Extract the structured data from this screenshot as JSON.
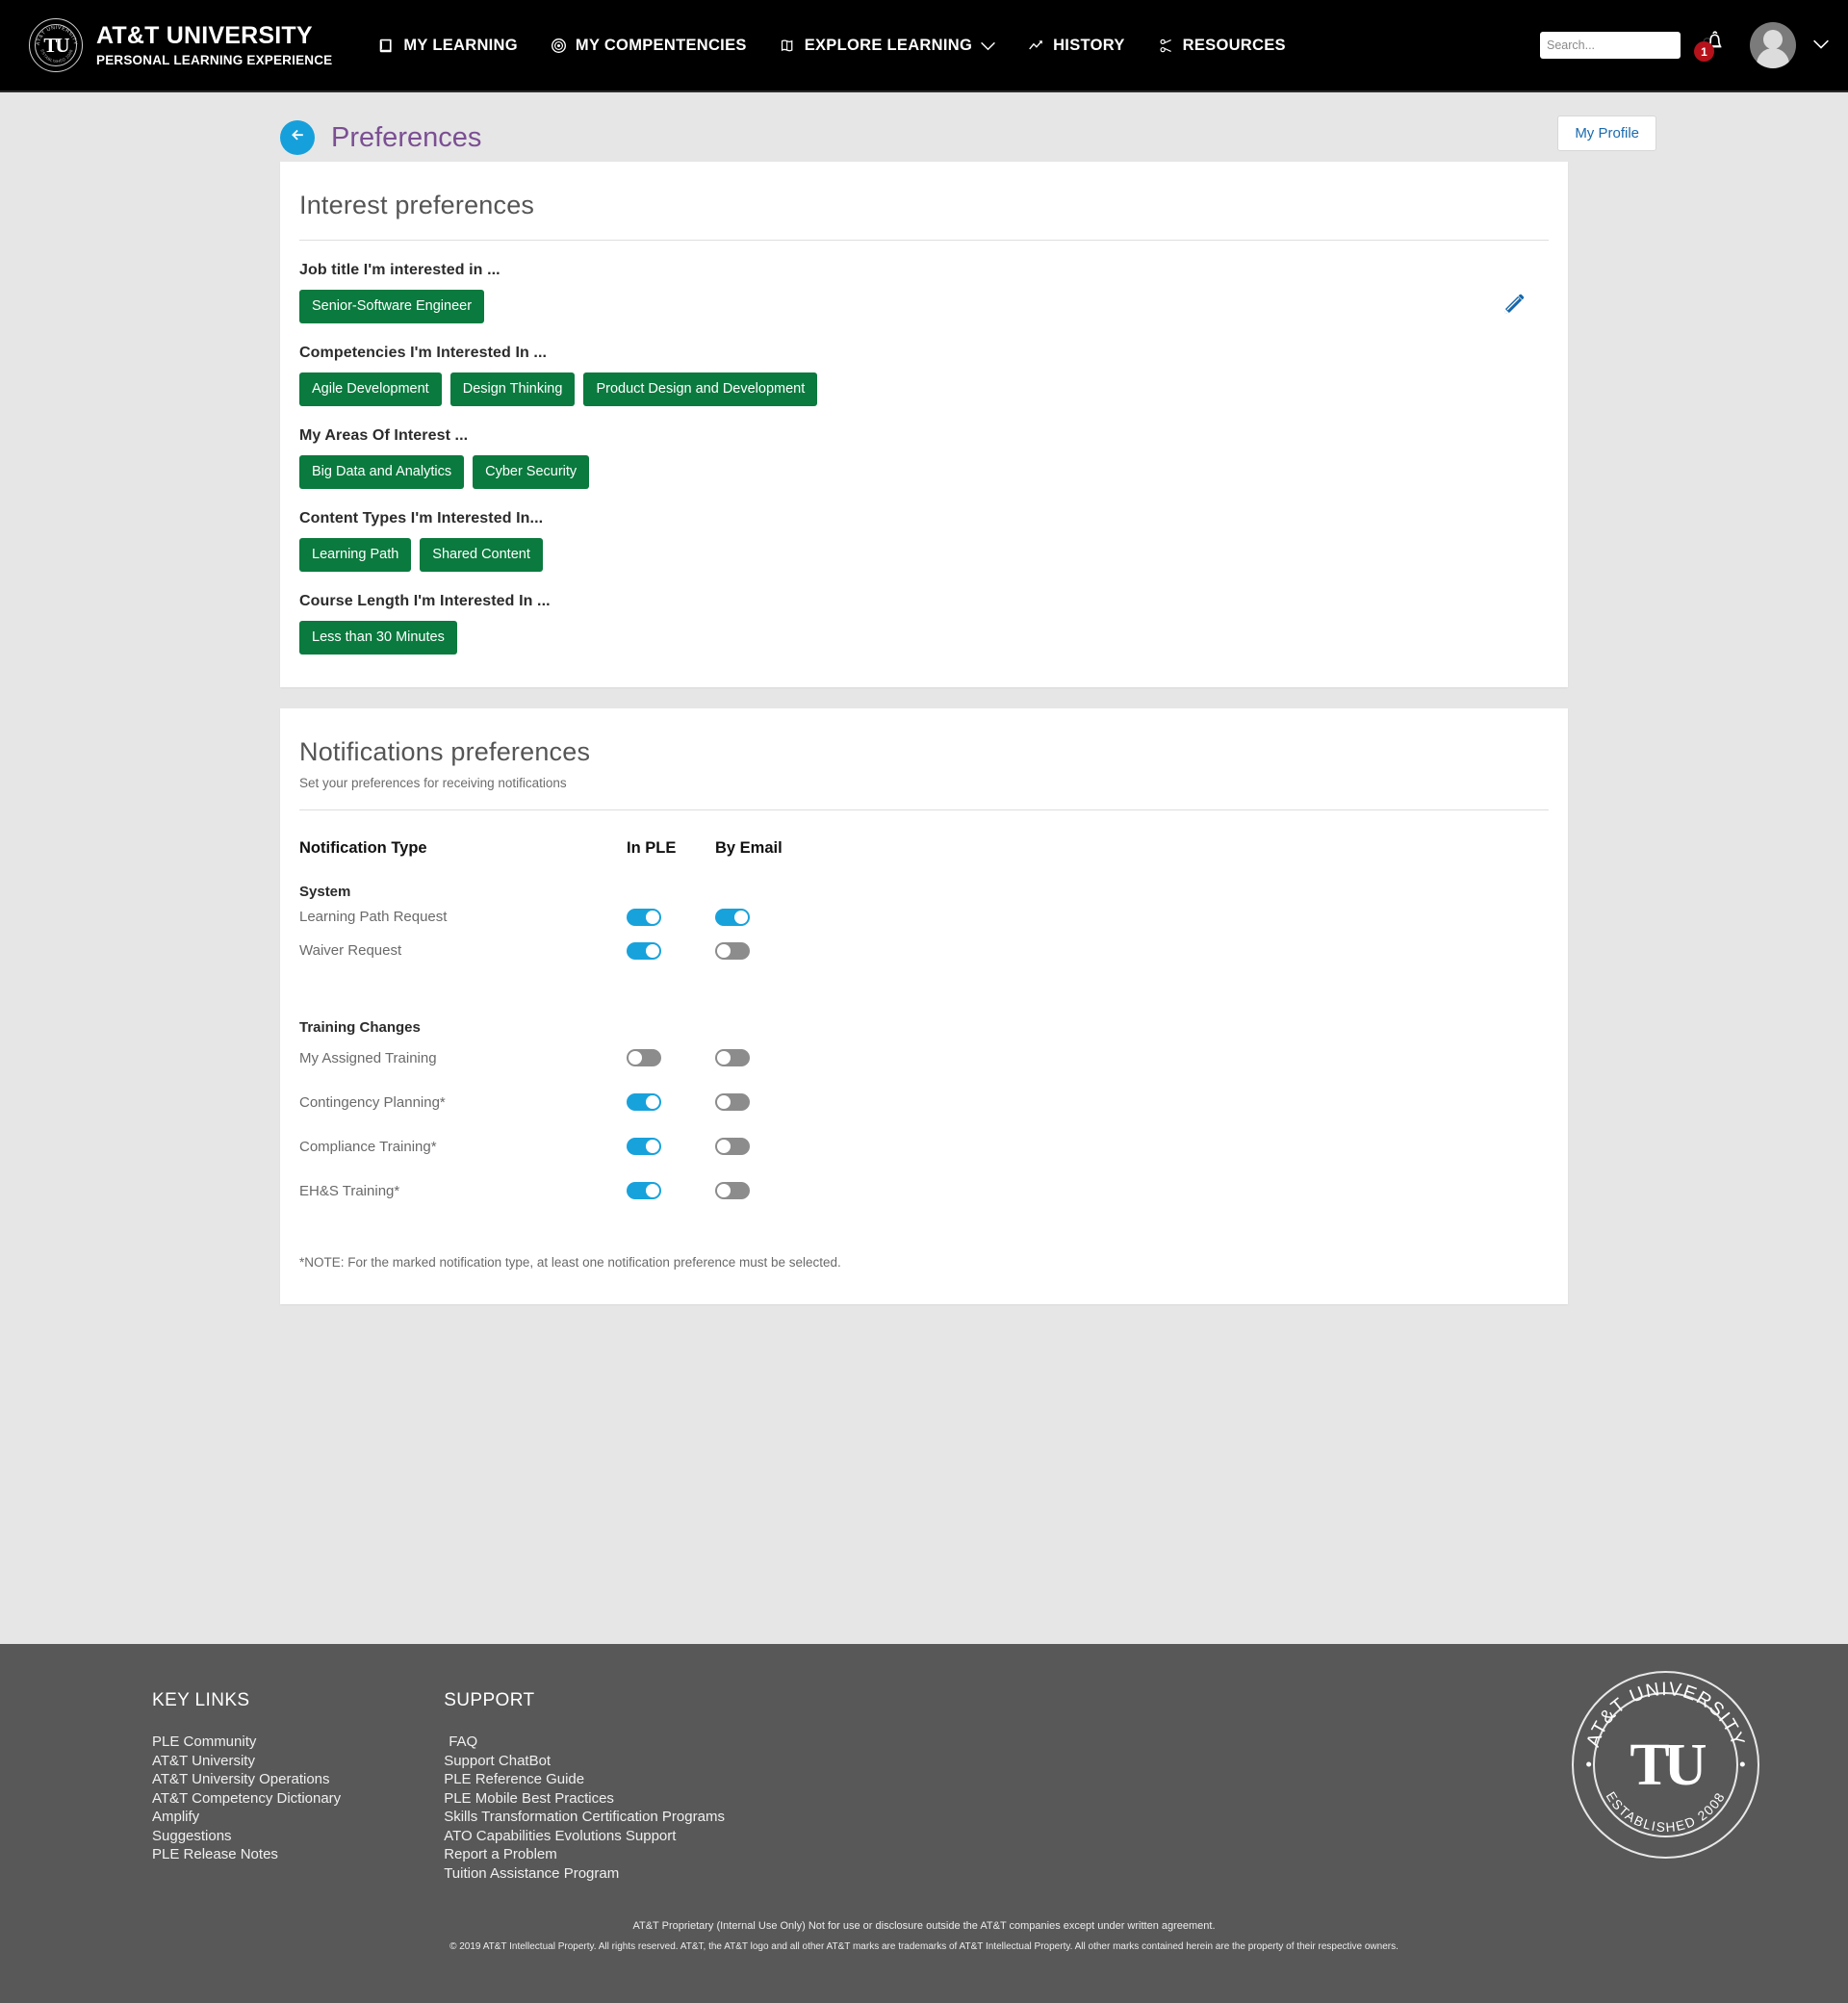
{
  "header": {
    "brand_title": "AT&T UNIVERSITY",
    "brand_subtitle": "PERSONAL LEARNING EXPERIENCE",
    "seal_initials": "TU",
    "nav": [
      {
        "label": "MY LEARNING",
        "icon": "book-icon",
        "has_caret": false
      },
      {
        "label": "MY COMPENTENCIES",
        "icon": "target-icon",
        "has_caret": false
      },
      {
        "label": "EXPLORE LEARNING",
        "icon": "map-icon",
        "has_caret": true
      },
      {
        "label": "HISTORY",
        "icon": "chart-line-icon",
        "has_caret": false
      },
      {
        "label": "RESOURCES",
        "icon": "link-icon",
        "has_caret": false
      }
    ],
    "search_placeholder": "Search...",
    "search_value": "",
    "notification_count": "1",
    "accent_dark": "#000000"
  },
  "page": {
    "title": "Preferences",
    "title_color": "#7b4f93",
    "back_button_color": "#15a0dc",
    "profile_button": "My Profile"
  },
  "interest": {
    "title": "Interest preferences",
    "edit_icon": "pencil-icon",
    "tag_color": "#0a7a3e",
    "groups": [
      {
        "label": "Job title I'm interested in ...",
        "tags": [
          "Senior-Software Engineer"
        ]
      },
      {
        "label": "Competencies I'm Interested In ...",
        "tags": [
          "Agile Development",
          "Design Thinking",
          "Product Design and Development"
        ]
      },
      {
        "label": "My Areas Of Interest ...",
        "tags": [
          "Big Data and Analytics",
          "Cyber Security"
        ]
      },
      {
        "label": "Content Types I'm Interested In...",
        "tags": [
          "Learning Path",
          "Shared Content"
        ]
      },
      {
        "label": "Course Length I'm Interested In ...",
        "tags": [
          "Less than 30 Minutes"
        ]
      }
    ]
  },
  "notifications": {
    "title": "Notifications preferences",
    "subtitle": "Set your preferences for receiving notifications",
    "columns": [
      "Notification Type",
      "In PLE",
      "By Email"
    ],
    "toggle_on_color": "#18a2dc",
    "toggle_off_color": "#8c8c8c",
    "groups": [
      {
        "name": "System",
        "rows": [
          {
            "label": "Learning Path Request",
            "in_ple": true,
            "by_email": true
          },
          {
            "label": "Waiver Request",
            "in_ple": true,
            "by_email": false
          }
        ]
      },
      {
        "name": "Training Changes",
        "rows": [
          {
            "label": "My Assigned Training",
            "in_ple": false,
            "by_email": false
          },
          {
            "label": "Contingency Planning*",
            "in_ple": true,
            "by_email": false
          },
          {
            "label": "Compliance Training*",
            "in_ple": true,
            "by_email": false
          },
          {
            "label": "EH&S Training*",
            "in_ple": true,
            "by_email": false
          }
        ]
      }
    ],
    "note": "*NOTE: For the marked notification type, at least one notification preference must be selected."
  },
  "footer": {
    "key_links_title": "KEY LINKS",
    "key_links": [
      "PLE Community",
      "AT&T University",
      "AT&T University Operations",
      "AT&T Competency Dictionary",
      "Amplify",
      "Suggestions",
      "PLE Release Notes"
    ],
    "support_title": "SUPPORT",
    "support_links": [
      "FAQ",
      "Support ChatBot",
      "PLE Reference Guide",
      "PLE Mobile Best Practices",
      "Skills Transformation Certification Programs",
      "ATO Capabilities Evolutions Support",
      "Report a Problem",
      "Tuition Assistance Program"
    ],
    "seal": {
      "top_text": "AT&T UNIVERSITY",
      "bottom_text": "ESTABLISHED 2008",
      "initials": "TU"
    },
    "legal_line1": "AT&T Proprietary (Internal Use Only) Not for use or disclosure outside the AT&T companies except under written agreement.",
    "legal_line2": "© 2019 AT&T Intellectual Property. All rights reserved. AT&T, the AT&T logo and all other AT&T marks are trademarks of AT&T Intellectual Property. All other marks contained herein are the property of their respective owners."
  }
}
